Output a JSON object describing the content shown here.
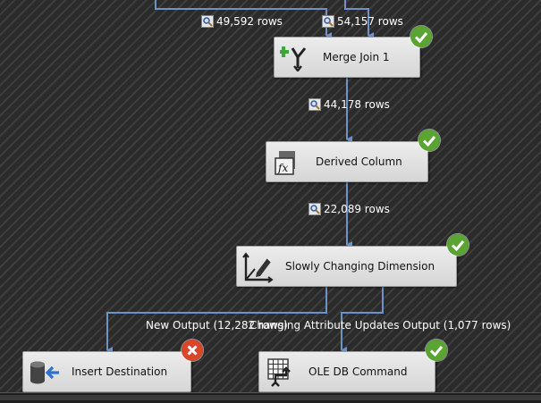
{
  "paths": {
    "p1_rows": "49,592 rows",
    "p2_rows": "54,157 rows",
    "p3_rows": "44,178 rows",
    "p4_rows": "22,089 rows"
  },
  "nodes": {
    "merge_join": {
      "label": "Merge Join 1",
      "status": "success"
    },
    "derived_column": {
      "label": "Derived Column",
      "status": "success"
    },
    "scd": {
      "label": "Slowly Changing Dimension",
      "status": "success"
    },
    "insert_destination": {
      "label": "Insert Destination",
      "status": "error"
    },
    "ole_db_command": {
      "label": "OLE DB Command",
      "status": "success"
    }
  },
  "outputs": {
    "new_output": "New Output (12,282 rows)",
    "changing_output": "Changing Attribute Updates Output (1,077 rows)"
  },
  "colors": {
    "connector": "#6f93c9",
    "success": "#5aa532",
    "error": "#d9472b"
  },
  "icons": {
    "merge_join": "merge-join-icon",
    "derived_column": "derived-column-icon",
    "scd": "slowly-changing-dimension-icon",
    "insert_destination": "destination-icon",
    "ole_db_command": "ole-db-command-icon",
    "path_viewer": "data-viewer-magnifier-icon"
  }
}
